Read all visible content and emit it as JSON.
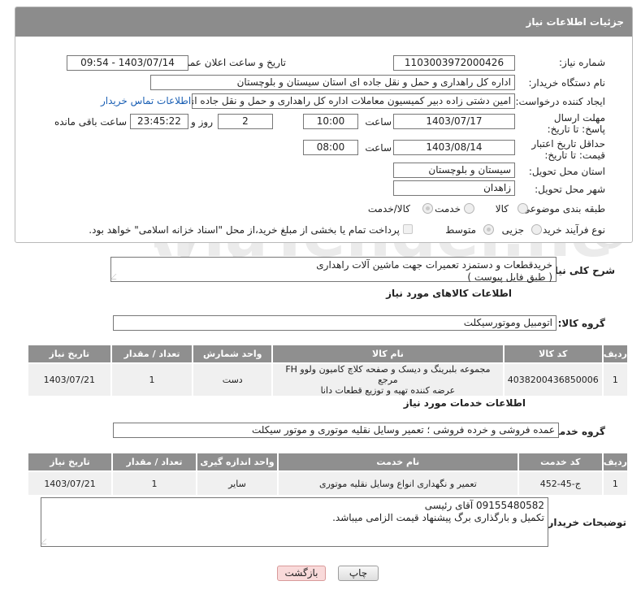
{
  "panel": {
    "title": "جزئیات اطلاعات نیاز"
  },
  "need_number": {
    "label": "شماره نیاز:",
    "value": "1103003972000426"
  },
  "announce_datetime": {
    "label": "تاریخ و ساعت اعلان عمومی:",
    "value": "1403/07/14 - 09:54"
  },
  "buyer_org": {
    "label": "نام دستگاه خریدار:",
    "value": "اداره کل راهداری و حمل و نقل جاده ای استان سیستان و بلوچستان"
  },
  "requester": {
    "label": "ایجاد کننده درخواست:",
    "value": "امین دشتی زاده دبیر کمیسیون معاملات اداره کل راهداری و حمل و نقل جاده ای",
    "contact_link": "اطلاعات تماس خریدار"
  },
  "reply_deadline": {
    "label": "مهلت ارسال پاسخ: تا تاریخ:",
    "date": "1403/07/17",
    "time_label": "ساعت",
    "time": "10:00",
    "days": "2",
    "days_label": "روز و",
    "remaining": "23:45:22",
    "remaining_label": "ساعت باقی مانده"
  },
  "price_validity": {
    "label": "حداقل تاریخ اعتبار قیمت: تا تاریخ:",
    "date": "1403/08/14",
    "time_label": "ساعت",
    "time": "08:00"
  },
  "delivery_province": {
    "label": "استان محل تحویل:",
    "value": "سیستان و بلوچستان"
  },
  "delivery_city": {
    "label": "شهر محل تحویل:",
    "value": "زاهدان"
  },
  "subject_class": {
    "label": "طبقه بندی موضوعی:",
    "options": [
      "کالا",
      "خدمت",
      "کالا/خدمت"
    ],
    "selected": "کالا/خدمت"
  },
  "process_type": {
    "label": "نوع فرآیند خرید :",
    "options": [
      "جزیی",
      "متوسط"
    ],
    "selected": "متوسط",
    "note": "پرداخت تمام یا بخشی از مبلغ خرید،از محل \"اسناد خزانه اسلامی\" خواهد بود."
  },
  "general_desc": {
    "label": "شرح کلی نیاز:",
    "line1": "خریدقطعات و دستمزد تعمیرات جهت ماشین آلات راهداری",
    "line2": "( طبق فایل پیوست )"
  },
  "goods_section": {
    "title": "اطلاعات کالاهای مورد نیاز",
    "group_label": "گروه کالا:",
    "group_value": "اتومبیل وموتورسیکلت",
    "columns": [
      "ردیف",
      "کد کالا",
      "نام کالا",
      "واحد شمارش",
      "تعداد / مقدار",
      "تاریخ نیاز"
    ],
    "rows": [
      {
        "row": "1",
        "code": "4038200436850006",
        "name_line1": "مجموعه بلبرینگ و دیسک و صفحه کلاچ کامیون ولوو FH مرجع",
        "name_line2": "عرضه کننده تهیه و توزیع قطعات دانا",
        "unit": "دست",
        "qty": "1",
        "date": "1403/07/21"
      }
    ]
  },
  "services_section": {
    "title": "اطلاعات خدمات مورد نیاز",
    "group_label": "گروه خدمت:",
    "group_value": "عمده فروشی و خرده فروشی ؛ تعمیر وسایل نقلیه موتوری و موتور سیکلت",
    "columns": [
      "ردیف",
      "کد خدمت",
      "نام خدمت",
      "واحد اندازه گیری",
      "تعداد / مقدار",
      "تاریخ نیاز"
    ],
    "rows": [
      {
        "row": "1",
        "code": "ج-45-452",
        "name": "تعمیر و نگهداری انواع وسایل نقلیه موتوری",
        "unit": "سایر",
        "qty": "1",
        "date": "1403/07/21"
      }
    ]
  },
  "buyer_notes": {
    "label": "توضیحات خریدار:",
    "line1": "09155480582 آقای رئیسی",
    "line2": "تکمیل و بارگذاری برگ پیشنهاد قیمت الزامی میباشد."
  },
  "buttons": {
    "print": "چاپ",
    "back": "بازگشت"
  },
  "watermark": {
    "text": "AriaTender.neT"
  },
  "colors": {
    "header_gray": "#8c8c8c",
    "link_blue": "#1a5fb4",
    "back_pink": "#f9dada"
  }
}
